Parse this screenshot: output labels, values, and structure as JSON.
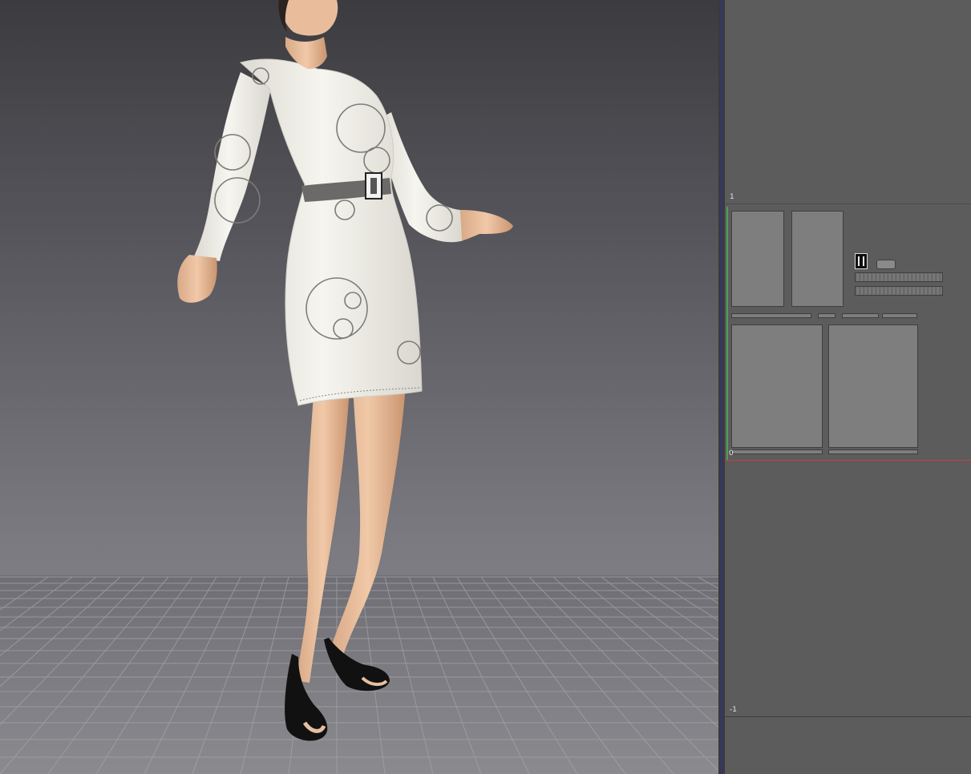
{
  "panel2d": {
    "axis_labels": {
      "top": "1",
      "middle": "0",
      "bottom": "-1"
    }
  },
  "colors": {
    "grid_floor": "#9c9ca0",
    "axis_x": "#c84040",
    "axis_y": "#4fa04f",
    "splitter_accent": "#35357a",
    "dress": "#f1efe8",
    "belt": "#6c6a68"
  },
  "icons": [
    "buckle-icon"
  ]
}
